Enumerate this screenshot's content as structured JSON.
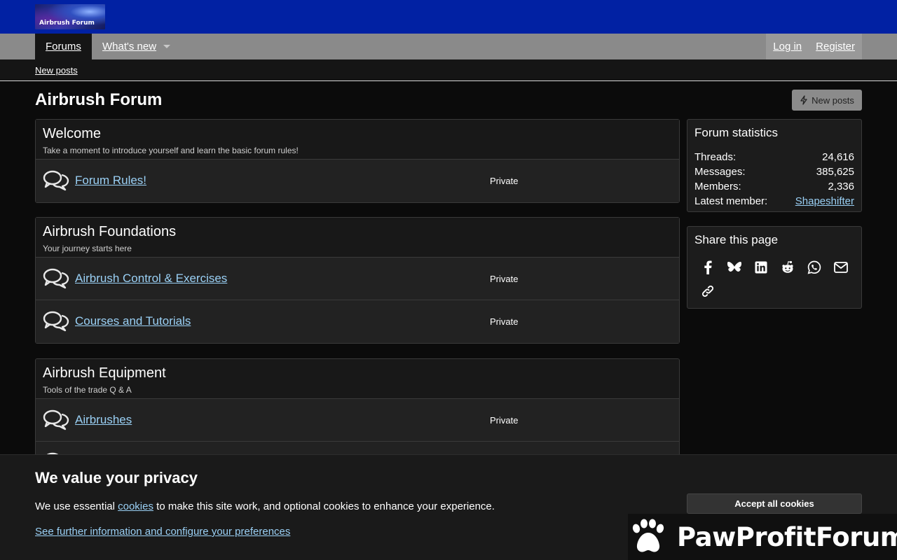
{
  "header": {
    "logo_text": "Airbrush Forum"
  },
  "nav": {
    "forums": "Forums",
    "whats_new": "What's new",
    "login": "Log in",
    "register": "Register",
    "sub_new_posts": "New posts"
  },
  "page": {
    "title": "Airbrush Forum",
    "new_posts_button": "New posts"
  },
  "categories": [
    {
      "title": "Welcome",
      "desc": "Take a moment to introduce yourself and learn the basic forum rules!",
      "nodes": [
        {
          "title": "Forum Rules!",
          "status": "Private"
        }
      ]
    },
    {
      "title": "Airbrush Foundations",
      "desc": "Your journey starts here",
      "nodes": [
        {
          "title": "Airbrush Control & Exercises",
          "status": "Private"
        },
        {
          "title": "Courses and Tutorials",
          "status": "Private"
        }
      ]
    },
    {
      "title": "Airbrush Equipment",
      "desc": "Tools of the trade Q & A",
      "nodes": [
        {
          "title": "Airbrushes",
          "status": "Private"
        }
      ]
    }
  ],
  "stats": {
    "title": "Forum statistics",
    "threads_label": "Threads:",
    "threads": "24,616",
    "messages_label": "Messages:",
    "messages": "385,625",
    "members_label": "Members:",
    "members": "2,336",
    "latest_label": "Latest member:",
    "latest": "Shapeshifter"
  },
  "share": {
    "title": "Share this page",
    "icons": [
      "facebook-icon",
      "bluesky-icon",
      "linkedin-icon",
      "reddit-icon",
      "whatsapp-icon",
      "email-icon",
      "link-icon"
    ]
  },
  "cookie": {
    "title": "We value your privacy",
    "text_before": "We use essential ",
    "text_link": "cookies",
    "text_after": " to make this site work, and optional cookies to enhance your experience.",
    "config_link": "See further information and configure your preferences",
    "accept": "Accept all cookies"
  },
  "watermark": {
    "text": "PawProfitForum"
  },
  "colors": {
    "header": "#0121a3",
    "link": "#9ad0f5",
    "nav": "#8a8a8a"
  }
}
